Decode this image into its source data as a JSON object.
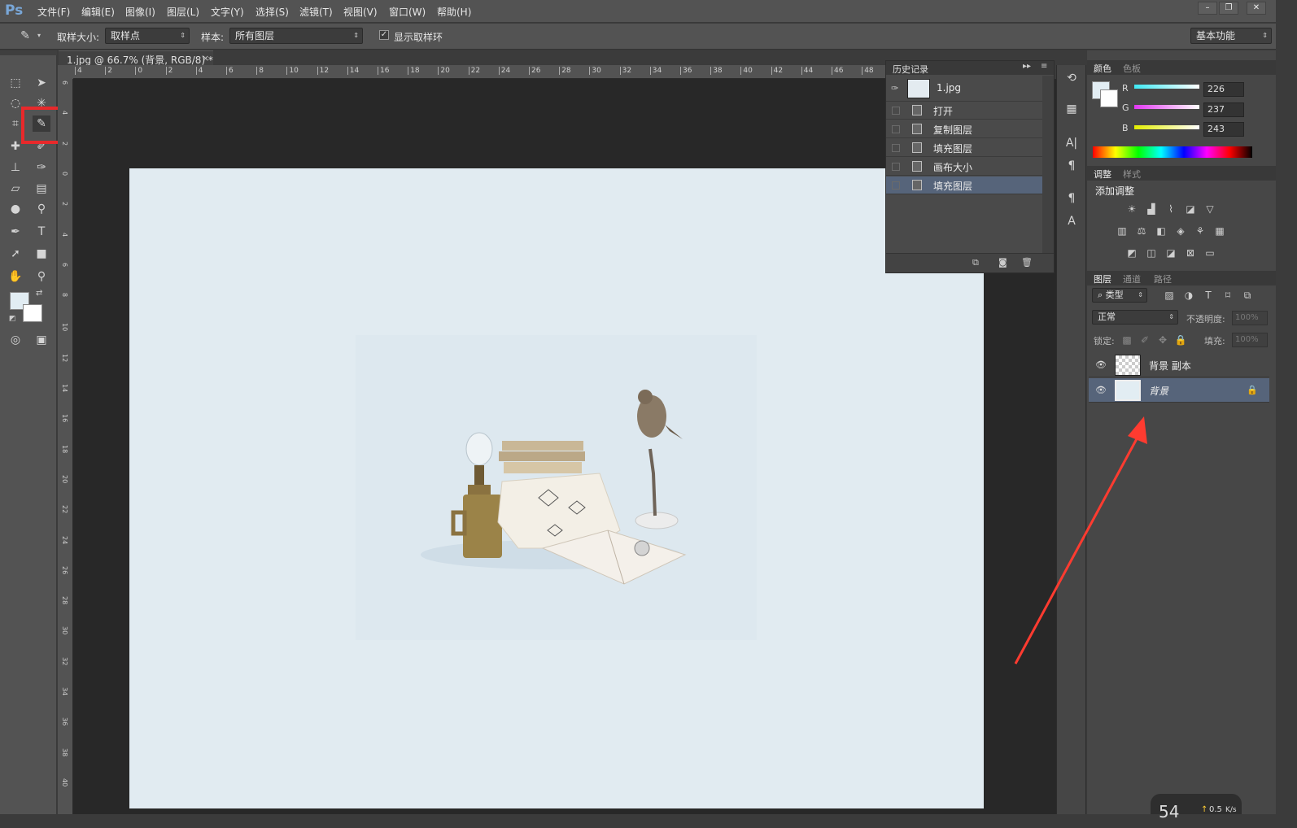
{
  "app": {
    "logo": "Ps"
  },
  "menu": [
    "文件(F)",
    "编辑(E)",
    "图像(I)",
    "图层(L)",
    "文字(Y)",
    "选择(S)",
    "滤镜(T)",
    "视图(V)",
    "窗口(W)",
    "帮助(H)"
  ],
  "window_controls": {
    "minimize": "–",
    "restore": "❐",
    "close": "✕"
  },
  "options_bar": {
    "sample_size_label": "取样大小:",
    "sample_size_value": "取样点",
    "sample_label": "样本:",
    "sample_value": "所有图层",
    "show_ring_label": "显示取样环",
    "workspace": "基本功能"
  },
  "document_tab": {
    "title": "1.jpg @ 66.7% (背景, RGB/8) *",
    "close": "×"
  },
  "ruler_top": [
    "4",
    "2",
    "0",
    "2",
    "4",
    "6",
    "8",
    "10",
    "12",
    "14",
    "16",
    "18",
    "20",
    "22",
    "24",
    "26",
    "28",
    "30",
    "32",
    "34",
    "36",
    "38",
    "40",
    "42",
    "44",
    "46",
    "48"
  ],
  "ruler_left": [
    "6",
    "4",
    "2",
    "0",
    "2",
    "4",
    "6",
    "8",
    "10",
    "12",
    "14",
    "16",
    "18",
    "20",
    "22",
    "24",
    "26",
    "28",
    "30",
    "32",
    "34",
    "36",
    "38",
    "40"
  ],
  "history": {
    "title": "历史记录",
    "snapshot": "1.jpg",
    "items": [
      "打开",
      "复制图层",
      "填充图层",
      "画布大小",
      "填充图层"
    ],
    "selected_index": 4
  },
  "color_panel": {
    "tabs": [
      "颜色",
      "色板"
    ],
    "channels": [
      {
        "name": "R",
        "value": "226"
      },
      {
        "name": "G",
        "value": "237"
      },
      {
        "name": "B",
        "value": "243"
      }
    ],
    "foreground": "#e2edf3"
  },
  "adjustments_panel": {
    "tabs": [
      "调整",
      "样式"
    ],
    "title": "添加调整"
  },
  "layers_panel": {
    "tabs": [
      "图层",
      "通道",
      "路径"
    ],
    "filter": "类型",
    "blend_mode": "正常",
    "opacity_label": "不透明度:",
    "opacity_value": "100%",
    "lock_label": "锁定:",
    "fill_label": "填充:",
    "fill_value": "100%",
    "layers": [
      {
        "name": "背景 副本",
        "selected": false
      },
      {
        "name": "背景",
        "selected": true
      }
    ]
  },
  "network_badge": {
    "value": "0.5",
    "unit": "K/s",
    "number": "54"
  },
  "colors": {
    "highlight_box": "#e8292b",
    "arrow": "#ff3b30",
    "canvas": "#e1ebf1",
    "selected_row": "#56647a"
  }
}
